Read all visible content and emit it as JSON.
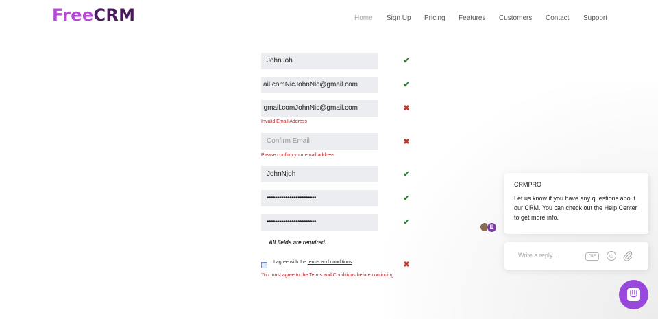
{
  "brand": {
    "logo_free": "Free",
    "logo_crm": "CRM",
    "free_color": "#b649d6",
    "crm_color": "#4a1b5c"
  },
  "nav": {
    "items": [
      {
        "label": "Home",
        "active": true
      },
      {
        "label": "Sign Up"
      },
      {
        "label": "Pricing"
      },
      {
        "label": "Features"
      },
      {
        "label": "Customers"
      },
      {
        "label": "Contact"
      },
      {
        "label": "Support"
      }
    ]
  },
  "form": {
    "first_name": {
      "value": "JohnJoh",
      "status": "valid"
    },
    "email": {
      "value": "ail.comNicJohnNic@gmail.com",
      "status": "valid"
    },
    "email2": {
      "value": "gmail.comJohnNic@gmail.com",
      "status": "invalid",
      "error": "Invalid Email Address"
    },
    "confirm_email": {
      "placeholder": "Confirm Email",
      "status": "invalid",
      "error": "Please confirm your email address"
    },
    "username": {
      "value": "JohnNjoh",
      "status": "valid"
    },
    "password": {
      "value": "••••••••••••••••••••••••",
      "status": "valid"
    },
    "confirm_password": {
      "value": "••••••••••••••••••••••••",
      "status": "valid"
    },
    "required_note": "All fields are required.",
    "terms": {
      "prefix": "I agree with the ",
      "link": "terms and conditions",
      "suffix": ".",
      "checked": false,
      "status": "invalid",
      "error": "You must agree to the Terms and Conditions before continuing"
    },
    "ok_glyph": "✔",
    "bad_glyph": "✖"
  },
  "chat": {
    "sender": "CRMPRO",
    "message_line1": "Let us know if you have any questions about our CRM.  You can check out the ",
    "help_link": "Help Center",
    "message_line2": " to get more info.",
    "avatar_initial": "E",
    "reply_placeholder": "Write a reply...",
    "gif_label": "GIF",
    "accent": "#9848dc"
  }
}
